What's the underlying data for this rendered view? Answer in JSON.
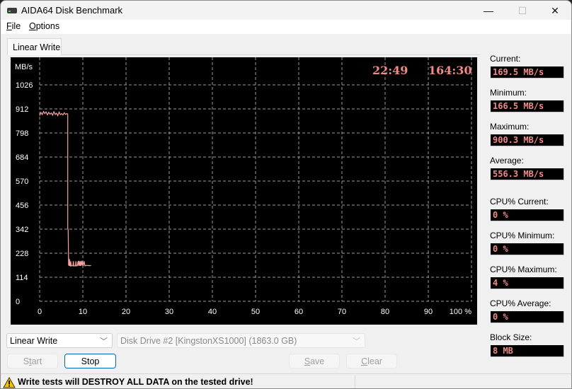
{
  "window": {
    "title": "AIDA64 Disk Benchmark",
    "controls": {
      "minimize": "—",
      "maximize": "☐",
      "close": "✕"
    }
  },
  "menu": [
    {
      "label": "File",
      "accel": "F",
      "rest": "ile"
    },
    {
      "label": "Options",
      "accel": "O",
      "rest": "ptions"
    }
  ],
  "tabs": [
    {
      "label": "Linear Write",
      "active": true
    }
  ],
  "chart_timers": {
    "elapsed": "22:49",
    "total": "164:30"
  },
  "chart_data": {
    "type": "line",
    "title": "Linear Write",
    "ylabel": "MB/s",
    "xlabel": "%",
    "ylim": [
      0,
      1026
    ],
    "xlim": [
      0,
      100
    ],
    "y_ticks": [
      0,
      114,
      228,
      342,
      456,
      570,
      684,
      798,
      912,
      1026
    ],
    "x_ticks": [
      0,
      10,
      20,
      30,
      40,
      50,
      60,
      70,
      80,
      90,
      100
    ],
    "x_tick_labels": [
      "0",
      "10",
      "20",
      "30",
      "40",
      "50",
      "60",
      "70",
      "80",
      "90",
      "100 %"
    ],
    "grid": true,
    "line_color": "#f5a3a0",
    "series": [
      {
        "name": "Linear Write",
        "x": [
          0,
          0.3,
          0.6,
          0.9,
          1.2,
          1.5,
          1.8,
          2.1,
          2.4,
          2.7,
          3.0,
          3.3,
          3.6,
          3.9,
          4.2,
          4.5,
          4.8,
          5.1,
          5.4,
          5.7,
          6.0,
          6.3,
          6.5,
          6.5,
          6.6,
          6.7,
          6.7,
          6.8,
          6.9,
          7.0,
          7.1,
          7.2,
          7.3,
          7.5,
          7.7,
          7.8,
          7.9,
          8.1,
          8.3,
          8.4,
          8.5,
          8.7,
          8.9,
          9.0,
          9.1,
          9.3,
          9.4,
          9.5,
          9.7,
          9.8,
          9.9,
          10.1,
          10.3,
          10.5,
          10.7,
          10.9,
          11.2,
          11.6,
          11.9
        ],
        "y": [
          880,
          895,
          885,
          900,
          890,
          898,
          884,
          896,
          887,
          893,
          882,
          899,
          886,
          892,
          880,
          897,
          885,
          890,
          883,
          894,
          886,
          890,
          888,
          345,
          340,
          170,
          210,
          168,
          200,
          170,
          168,
          190,
          168,
          169,
          168,
          190,
          168,
          168,
          168,
          190,
          168,
          168,
          190,
          168,
          192,
          168,
          190,
          168,
          192,
          170,
          190,
          168,
          190,
          168,
          170,
          170,
          170,
          169,
          169.5
        ]
      }
    ]
  },
  "stats": [
    {
      "label": "Current:",
      "value": "169.5 MB/s"
    },
    {
      "label": "Minimum:",
      "value": "166.5 MB/s"
    },
    {
      "label": "Maximum:",
      "value": "900.3 MB/s"
    },
    {
      "label": "Average:",
      "value": "556.3 MB/s"
    },
    {
      "label": "CPU% Current:",
      "value": "0 %"
    },
    {
      "label": "CPU% Minimum:",
      "value": "0 %"
    },
    {
      "label": "CPU% Maximum:",
      "value": "4 %"
    },
    {
      "label": "CPU% Average:",
      "value": "0 %"
    },
    {
      "label": "Block Size:",
      "value": "8 MB"
    }
  ],
  "controls": {
    "test_select": "Linear Write",
    "drive_select": "Disk Drive #2  [KingstonXS1000]  (1863.0 GB)",
    "start": {
      "accel_before": "S",
      "accel": "t",
      "after": "art",
      "label": "Start",
      "enabled": false
    },
    "stop": {
      "label": "Stop",
      "enabled": true
    },
    "save": {
      "accel": "S",
      "after": "ave",
      "label": "Save",
      "enabled": false
    },
    "clear": {
      "accel": "C",
      "after": "lear",
      "label": "Clear",
      "enabled": false
    }
  },
  "status": {
    "warning": "Write tests will DESTROY ALL DATA on the tested drive!"
  }
}
